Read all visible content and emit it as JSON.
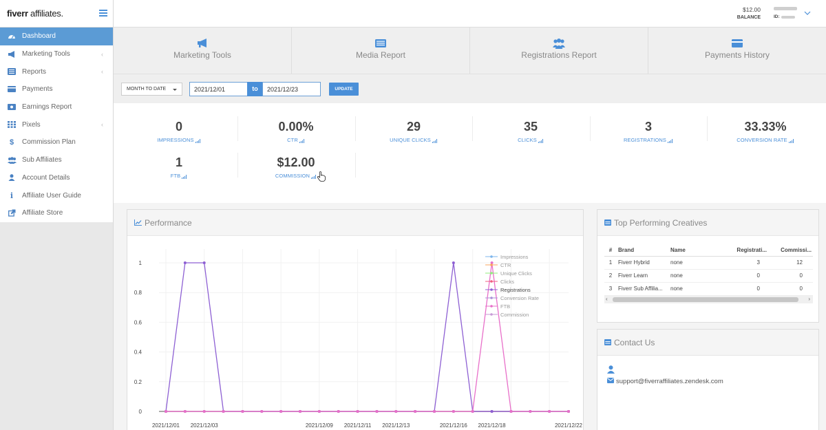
{
  "app": {
    "logo_bold": "fiverr",
    "logo_light": " affiliates."
  },
  "sidebar": {
    "items": [
      {
        "label": "Dashboard",
        "icon": "dashboard-icon",
        "active": true
      },
      {
        "label": "Marketing Tools",
        "icon": "megaphone-icon",
        "has_children": true
      },
      {
        "label": "Reports",
        "icon": "list-icon",
        "has_children": true
      },
      {
        "label": "Payments",
        "icon": "credit-card-icon"
      },
      {
        "label": "Earnings Report",
        "icon": "money-icon"
      },
      {
        "label": "Pixels",
        "icon": "grid-icon",
        "has_children": true
      },
      {
        "label": "Commission Plan",
        "icon": "dollar-icon"
      },
      {
        "label": "Sub Affiliates",
        "icon": "users-icon"
      },
      {
        "label": "Account Details",
        "icon": "user-icon"
      },
      {
        "label": "Affiliate User Guide",
        "icon": "info-icon"
      },
      {
        "label": "Affiliate Store",
        "icon": "external-link-icon"
      }
    ]
  },
  "topbar": {
    "balance_value": "$12.00",
    "balance_label": "BALANCE",
    "id_label": "ID:"
  },
  "quicknav": [
    {
      "label": "Marketing Tools",
      "icon": "megaphone-icon"
    },
    {
      "label": "Media Report",
      "icon": "list-alt-icon"
    },
    {
      "label": "Registrations Report",
      "icon": "users-icon"
    },
    {
      "label": "Payments History",
      "icon": "credit-card-icon"
    }
  ],
  "filter": {
    "period": "MONTH TO DATE",
    "from": "2021/12/01",
    "separator": "to",
    "to": "2021/12/23",
    "update_label": "UPDATE"
  },
  "kpis": [
    {
      "value": "0",
      "label": "IMPRESSIONS"
    },
    {
      "value": "0.00%",
      "label": "CTR"
    },
    {
      "value": "29",
      "label": "UNIQUE CLICKS"
    },
    {
      "value": "35",
      "label": "CLICKS"
    },
    {
      "value": "3",
      "label": "REGISTRATIONS"
    },
    {
      "value": "33.33%",
      "label": "CONVERSION RATE"
    },
    {
      "value": "1",
      "label": "FTB"
    },
    {
      "value": "$12.00",
      "label": "COMMISSION"
    }
  ],
  "performance": {
    "title": "Performance"
  },
  "chart_data": {
    "type": "line",
    "x": [
      "2021/12/01",
      "2021/12/02",
      "2021/12/03",
      "2021/12/04",
      "2021/12/05",
      "2021/12/06",
      "2021/12/07",
      "2021/12/08",
      "2021/12/09",
      "2021/12/10",
      "2021/12/11",
      "2021/12/12",
      "2021/12/13",
      "2021/12/14",
      "2021/12/15",
      "2021/12/16",
      "2021/12/17",
      "2021/12/18",
      "2021/12/19",
      "2021/12/20",
      "2021/12/21",
      "2021/12/22"
    ],
    "x_tick_labels": [
      "2021/12/01",
      "2021/12/03",
      "2021/12/09",
      "2021/12/11",
      "2021/12/13",
      "2021/12/16",
      "2021/12/18",
      "2021/12/22"
    ],
    "ylim": [
      0,
      1
    ],
    "y_ticks": [
      "0",
      "0.2",
      "0.4",
      "0.6",
      "0.8",
      "1"
    ],
    "legend_position": "top-right",
    "grid": true,
    "series": [
      {
        "name": "Impressions",
        "color": "#7cb5ec",
        "values": [
          0,
          0,
          0,
          0,
          0,
          0,
          0,
          0,
          0,
          0,
          0,
          0,
          0,
          0,
          0,
          0,
          0,
          0,
          0,
          0,
          0,
          0
        ]
      },
      {
        "name": "CTR",
        "color": "#f7a35c",
        "values": [
          0,
          0,
          0,
          0,
          0,
          0,
          0,
          0,
          0,
          0,
          0,
          0,
          0,
          0,
          0,
          0,
          0,
          0,
          0,
          0,
          0,
          0
        ]
      },
      {
        "name": "Unique Clicks",
        "color": "#90ed7d",
        "values": [
          0,
          0,
          0,
          0,
          0,
          0,
          0,
          0,
          0,
          0,
          0,
          0,
          0,
          0,
          0,
          0,
          0,
          0,
          0,
          0,
          0,
          0
        ]
      },
      {
        "name": "Clicks",
        "color": "#f15c80",
        "values": [
          0,
          0,
          0,
          0,
          0,
          0,
          0,
          0,
          0,
          0,
          0,
          0,
          0,
          0,
          0,
          0,
          0,
          0,
          0,
          0,
          0,
          0
        ]
      },
      {
        "name": "Registrations",
        "color": "#8d5fd3",
        "values": [
          0,
          1,
          1,
          0,
          0,
          0,
          0,
          0,
          0,
          0,
          0,
          0,
          0,
          0,
          0,
          1,
          0,
          0,
          0,
          0,
          0,
          0
        ]
      },
      {
        "name": "Conversion Rate",
        "color": "#a98fd8",
        "values": [
          0,
          0,
          0,
          0,
          0,
          0,
          0,
          0,
          0,
          0,
          0,
          0,
          0,
          0,
          0,
          0,
          0,
          0,
          0,
          0,
          0,
          0
        ]
      },
      {
        "name": "FTB",
        "color": "#e86fc9",
        "values": [
          0,
          0,
          0,
          0,
          0,
          0,
          0,
          0,
          0,
          0,
          0,
          0,
          0,
          0,
          0,
          0,
          0,
          1,
          0,
          0,
          0,
          0
        ]
      },
      {
        "name": "Commission",
        "color": "#c79ad6",
        "values": [
          0,
          0,
          0,
          0,
          0,
          0,
          0,
          0,
          0,
          0,
          0,
          0,
          0,
          0,
          0,
          0,
          0,
          0,
          0,
          0,
          0,
          0
        ]
      }
    ]
  },
  "creatives": {
    "title": "Top Performing Creatives",
    "columns": [
      "#",
      "Brand",
      "Name",
      "Registrati...",
      "Commissi..."
    ],
    "rows": [
      [
        "1",
        "Fiverr Hybrid",
        "none",
        "3",
        "12"
      ],
      [
        "2",
        "Fiverr Learn",
        "none",
        "0",
        "0"
      ],
      [
        "3",
        "Fiverr Sub Affilia...",
        "none",
        "0",
        "0"
      ]
    ]
  },
  "contact": {
    "title": "Contact Us",
    "email": "support@fiverraffiliates.zendesk.com"
  },
  "colors": {
    "accent": "#4a8fd8",
    "sidebar_active": "#5b9bd5"
  }
}
